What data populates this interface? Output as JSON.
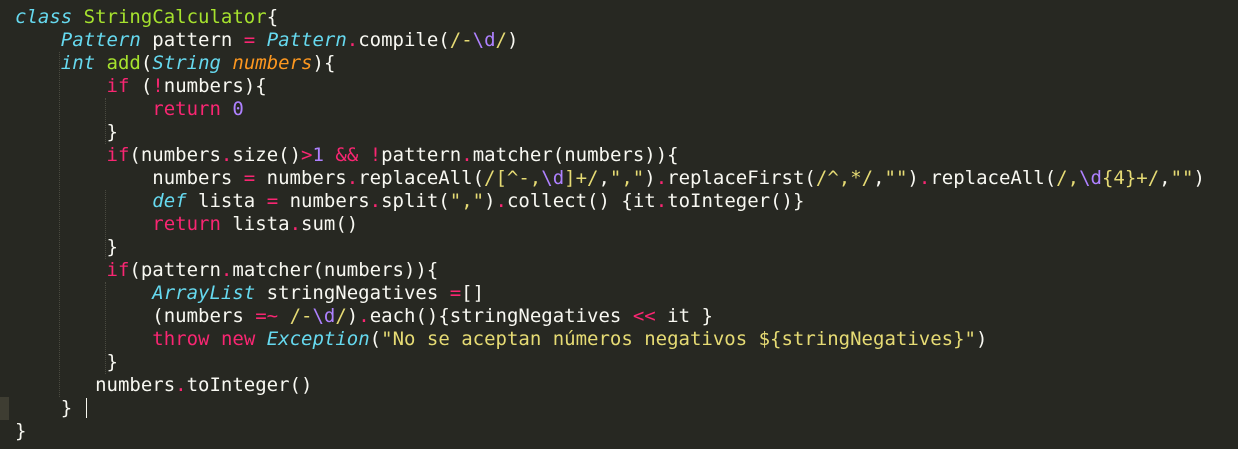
{
  "editor": {
    "theme": {
      "background": "#272822",
      "foreground": "#f8f8f2",
      "keyword": "#f92672",
      "type": "#66d9ef",
      "class": "#a6e22e",
      "number": "#ae81ff",
      "string": "#e6db74",
      "param": "#fd971f"
    },
    "lines": [
      [
        {
          "c": "kwi",
          "t": "class"
        },
        {
          "c": "plain",
          "t": " "
        },
        {
          "c": "cls",
          "t": "StringCalculator"
        },
        {
          "c": "plain",
          "t": "{"
        }
      ],
      [
        {
          "c": "plain",
          "t": "    "
        },
        {
          "c": "ty",
          "t": "Pattern"
        },
        {
          "c": "plain",
          "t": " pattern "
        },
        {
          "c": "op",
          "t": "="
        },
        {
          "c": "plain",
          "t": " "
        },
        {
          "c": "ty",
          "t": "Pattern"
        },
        {
          "c": "op",
          "t": "."
        },
        {
          "c": "plain",
          "t": "compile("
        },
        {
          "c": "str",
          "t": "/-"
        },
        {
          "c": "esc",
          "t": "\\d"
        },
        {
          "c": "str",
          "t": "/"
        },
        {
          "c": "plain",
          "t": ")"
        }
      ],
      [
        {
          "c": "plain",
          "t": "    "
        },
        {
          "c": "kwi",
          "t": "int"
        },
        {
          "c": "plain",
          "t": " "
        },
        {
          "c": "cls",
          "t": "add"
        },
        {
          "c": "plain",
          "t": "("
        },
        {
          "c": "ty",
          "t": "String"
        },
        {
          "c": "plain",
          "t": " "
        },
        {
          "c": "param",
          "t": "numbers"
        },
        {
          "c": "plain",
          "t": "){"
        }
      ],
      [
        {
          "c": "plain",
          "t": "        "
        },
        {
          "c": "kw",
          "t": "if"
        },
        {
          "c": "plain",
          "t": " ("
        },
        {
          "c": "op",
          "t": "!"
        },
        {
          "c": "plain",
          "t": "numbers){"
        }
      ],
      [
        {
          "c": "plain",
          "t": "            "
        },
        {
          "c": "kw",
          "t": "return"
        },
        {
          "c": "plain",
          "t": " "
        },
        {
          "c": "num",
          "t": "0"
        }
      ],
      [
        {
          "c": "plain",
          "t": "        }"
        }
      ],
      [
        {
          "c": "plain",
          "t": "        "
        },
        {
          "c": "kw",
          "t": "if"
        },
        {
          "c": "plain",
          "t": "(numbers"
        },
        {
          "c": "op",
          "t": "."
        },
        {
          "c": "plain",
          "t": "size()"
        },
        {
          "c": "op",
          "t": ">"
        },
        {
          "c": "num",
          "t": "1"
        },
        {
          "c": "plain",
          "t": " "
        },
        {
          "c": "op",
          "t": "&&"
        },
        {
          "c": "plain",
          "t": " "
        },
        {
          "c": "op",
          "t": "!"
        },
        {
          "c": "plain",
          "t": "pattern"
        },
        {
          "c": "op",
          "t": "."
        },
        {
          "c": "plain",
          "t": "matcher(numbers)){"
        }
      ],
      [
        {
          "c": "plain",
          "t": "            numbers "
        },
        {
          "c": "op",
          "t": "="
        },
        {
          "c": "plain",
          "t": " numbers"
        },
        {
          "c": "op",
          "t": "."
        },
        {
          "c": "plain",
          "t": "replaceAll("
        },
        {
          "c": "str",
          "t": "/[^-,"
        },
        {
          "c": "esc",
          "t": "\\d"
        },
        {
          "c": "str",
          "t": "]+/"
        },
        {
          "c": "plain",
          "t": ","
        },
        {
          "c": "str",
          "t": "\",\""
        },
        {
          "c": "plain",
          "t": ")"
        },
        {
          "c": "op",
          "t": "."
        },
        {
          "c": "plain",
          "t": "replaceFirst("
        },
        {
          "c": "str",
          "t": "/^,*/"
        },
        {
          "c": "plain",
          "t": ","
        },
        {
          "c": "str",
          "t": "\"\""
        },
        {
          "c": "plain",
          "t": ")"
        },
        {
          "c": "op",
          "t": "."
        },
        {
          "c": "plain",
          "t": "replaceAll("
        },
        {
          "c": "str",
          "t": "/,"
        },
        {
          "c": "esc",
          "t": "\\d"
        },
        {
          "c": "str",
          "t": "{4}+/"
        },
        {
          "c": "plain",
          "t": ","
        },
        {
          "c": "str",
          "t": "\"\""
        },
        {
          "c": "plain",
          "t": ")"
        }
      ],
      [
        {
          "c": "plain",
          "t": "            "
        },
        {
          "c": "kwi",
          "t": "def"
        },
        {
          "c": "plain",
          "t": " lista "
        },
        {
          "c": "op",
          "t": "="
        },
        {
          "c": "plain",
          "t": " numbers"
        },
        {
          "c": "op",
          "t": "."
        },
        {
          "c": "plain",
          "t": "split("
        },
        {
          "c": "str",
          "t": "\",\""
        },
        {
          "c": "plain",
          "t": ")"
        },
        {
          "c": "op",
          "t": "."
        },
        {
          "c": "plain",
          "t": "collect() {it"
        },
        {
          "c": "op",
          "t": "."
        },
        {
          "c": "plain",
          "t": "toInteger()}"
        }
      ],
      [
        {
          "c": "plain",
          "t": "            "
        },
        {
          "c": "kw",
          "t": "return"
        },
        {
          "c": "plain",
          "t": " lista"
        },
        {
          "c": "op",
          "t": "."
        },
        {
          "c": "plain",
          "t": "sum()"
        }
      ],
      [
        {
          "c": "plain",
          "t": "        }"
        }
      ],
      [
        {
          "c": "plain",
          "t": "        "
        },
        {
          "c": "kw",
          "t": "if"
        },
        {
          "c": "plain",
          "t": "(pattern"
        },
        {
          "c": "op",
          "t": "."
        },
        {
          "c": "plain",
          "t": "matcher(numbers)){"
        }
      ],
      [
        {
          "c": "plain",
          "t": "            "
        },
        {
          "c": "ty",
          "t": "ArrayList"
        },
        {
          "c": "plain",
          "t": " stringNegatives "
        },
        {
          "c": "op",
          "t": "="
        },
        {
          "c": "plain",
          "t": "[]"
        }
      ],
      [
        {
          "c": "plain",
          "t": "            (numbers "
        },
        {
          "c": "op",
          "t": "=~"
        },
        {
          "c": "plain",
          "t": " "
        },
        {
          "c": "str",
          "t": "/-"
        },
        {
          "c": "esc",
          "t": "\\d"
        },
        {
          "c": "str",
          "t": "/"
        },
        {
          "c": "plain",
          "t": ")"
        },
        {
          "c": "op",
          "t": "."
        },
        {
          "c": "plain",
          "t": "each(){stringNegatives "
        },
        {
          "c": "op",
          "t": "<<"
        },
        {
          "c": "plain",
          "t": " it }"
        }
      ],
      [
        {
          "c": "plain",
          "t": "            "
        },
        {
          "c": "kw",
          "t": "throw"
        },
        {
          "c": "plain",
          "t": " "
        },
        {
          "c": "kw",
          "t": "new"
        },
        {
          "c": "plain",
          "t": " "
        },
        {
          "c": "ty",
          "t": "Exception"
        },
        {
          "c": "plain",
          "t": "("
        },
        {
          "c": "str",
          "t": "\"No se aceptan números negativos ${stringNegatives}\""
        },
        {
          "c": "plain",
          "t": ")"
        }
      ],
      [
        {
          "c": "plain",
          "t": "        }"
        }
      ],
      [
        {
          "c": "plain",
          "t": "       numbers"
        },
        {
          "c": "op",
          "t": "."
        },
        {
          "c": "plain",
          "t": "toInteger()"
        }
      ],
      [
        {
          "c": "plain",
          "t": "    } "
        }
      ],
      [
        {
          "c": "plain",
          "t": "}"
        }
      ]
    ],
    "caret_line": 17,
    "highlighted_line": 17
  }
}
